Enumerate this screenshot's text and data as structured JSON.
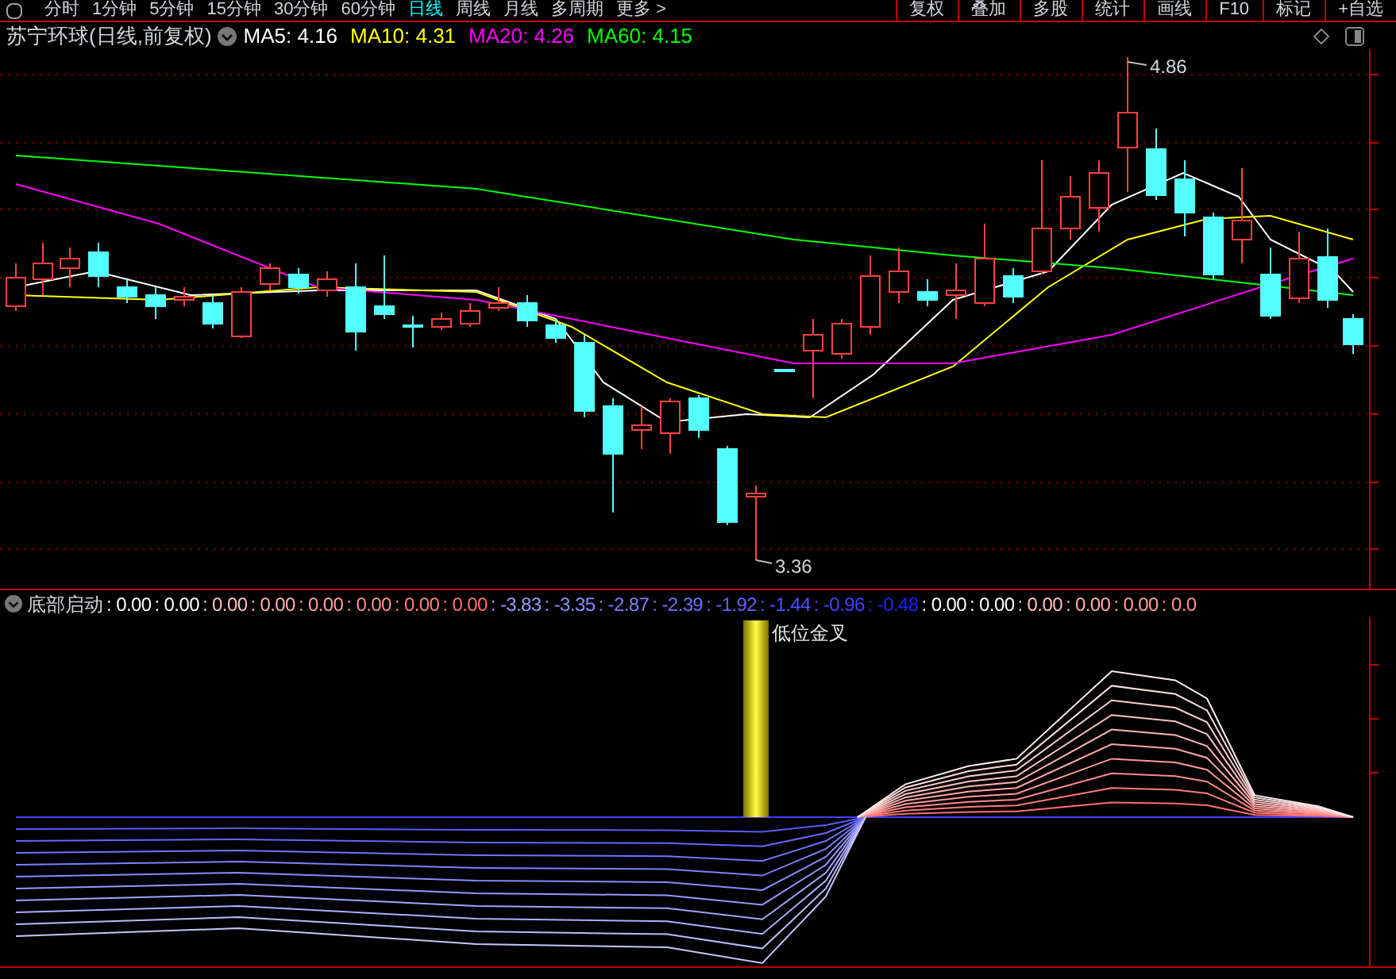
{
  "toolbar": {
    "periods": [
      {
        "label": "分时",
        "selected": false
      },
      {
        "label": "1分钟",
        "selected": false
      },
      {
        "label": "5分钟",
        "selected": false
      },
      {
        "label": "15分钟",
        "selected": false
      },
      {
        "label": "30分钟",
        "selected": false
      },
      {
        "label": "60分钟",
        "selected": false
      },
      {
        "label": "日线",
        "selected": true
      },
      {
        "label": "周线",
        "selected": false
      },
      {
        "label": "月线",
        "selected": false
      },
      {
        "label": "多周期",
        "selected": false
      },
      {
        "label": "更多 >",
        "selected": false
      }
    ],
    "tools": [
      "复权",
      "叠加",
      "多股",
      "统计",
      "画线",
      "F10",
      "标记",
      "+自选"
    ]
  },
  "main_panel": {
    "title": "苏宁环球(日线,前复权)",
    "moving_averages": [
      {
        "label": "MA5: 4.16",
        "color": "#ffffff"
      },
      {
        "label": "MA10: 4.31",
        "color": "#ffff00"
      },
      {
        "label": "MA20: 4.26",
        "color": "#ff00ff"
      },
      {
        "label": "MA60: 4.15",
        "color": "#00ff00"
      }
    ],
    "high_label": "4.86",
    "low_label": "3.36"
  },
  "indicator_panel": {
    "name": "底部启动",
    "values": [
      {
        "text": ": 0.00",
        "color": "#ffffff"
      },
      {
        "text": ": 0.00",
        "color": "#ffffff"
      },
      {
        "text": ": 0.00",
        "color": "#ffc0c0"
      },
      {
        "text": ": 0.00",
        "color": "#ffb0b0"
      },
      {
        "text": ": 0.00",
        "color": "#ffa0a0"
      },
      {
        "text": ": 0.00",
        "color": "#ff9090"
      },
      {
        "text": ": 0.00",
        "color": "#ff8080"
      },
      {
        "text": ": 0.00",
        "color": "#ff7070"
      },
      {
        "text": ": -3.83",
        "color": "#9a9aff"
      },
      {
        "text": ": -3.35",
        "color": "#8c8cff"
      },
      {
        "text": ": -2.87",
        "color": "#7e7eff"
      },
      {
        "text": ": -2.39",
        "color": "#7070ff"
      },
      {
        "text": ": -1.92",
        "color": "#6060ff"
      },
      {
        "text": ": -1.44",
        "color": "#5050ff"
      },
      {
        "text": ": -0.96",
        "color": "#4040ff"
      },
      {
        "text": ": -0.48",
        "color": "#2020ff"
      },
      {
        "text": ": 0.00",
        "color": "#ffffff"
      },
      {
        "text": ": 0.00",
        "color": "#ffffff"
      },
      {
        "text": ": 0.00",
        "color": "#ffc0c0"
      },
      {
        "text": ": 0.00",
        "color": "#ffb0b0"
      },
      {
        "text": ": 0.00",
        "color": "#ffa0a0"
      },
      {
        "text": ": 0.0",
        "color": "#ff9090"
      }
    ],
    "signal_label": "低位金叉"
  }
}
